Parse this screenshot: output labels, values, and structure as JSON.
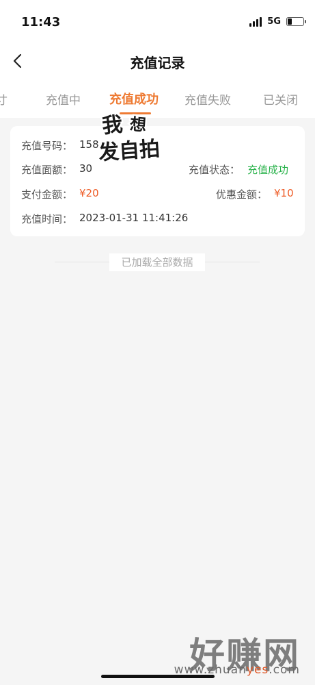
{
  "status_bar": {
    "time": "11:43",
    "network": "5G"
  },
  "navbar": {
    "title": "充值记录"
  },
  "tabs": [
    {
      "label": "寸"
    },
    {
      "label": "充值中"
    },
    {
      "label": "充值成功"
    },
    {
      "label": "充值失败"
    },
    {
      "label": "已关闭"
    }
  ],
  "record": {
    "number_label": "充值号码：",
    "number_value": "158",
    "face_label": "充值面额：",
    "face_value": "30",
    "status_label": "充值状态：",
    "status_value": "充值成功",
    "pay_label": "支付金额：",
    "pay_value": "¥20",
    "discount_label": "优惠金额：",
    "discount_value": "¥10",
    "time_label": "充值时间：",
    "time_value": "2023-01-31 11:41:26"
  },
  "sticker": {
    "line1": "我想",
    "line2": "发自拍"
  },
  "footer": {
    "loaded_text": "已加载全部数据"
  },
  "watermark": {
    "big": "好赚网",
    "url_prefix": "www.zhuan",
    "url_highlight": "yes",
    "url_suffix": ".com"
  },
  "colors": {
    "accent": "#ee7a32",
    "success": "#28b24a",
    "money": "#ee5a24"
  }
}
